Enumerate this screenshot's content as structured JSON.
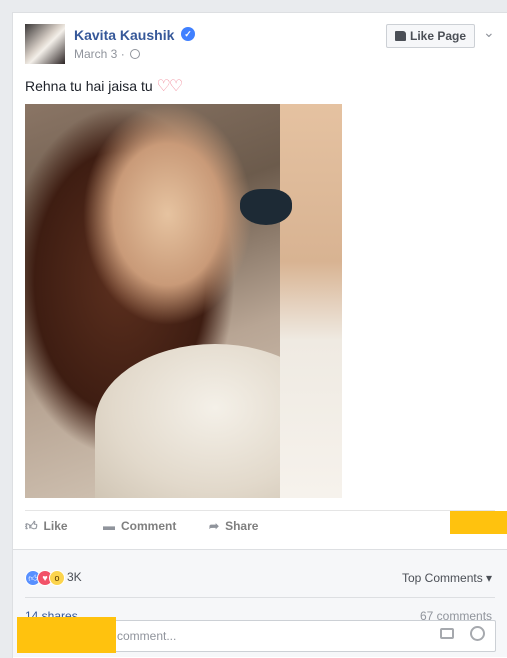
{
  "post": {
    "author": "Kavita Kaushik",
    "date": "March 3",
    "date_sep": "·",
    "text": "Rehna tu hai jaisa tu",
    "text_emoji": "♡♡",
    "like_page_label": "Like Page"
  },
  "actions": {
    "like": "Like",
    "comment": "Comment",
    "share": "Share"
  },
  "stats": {
    "reaction_count": "3K",
    "top_comments": "Top Comments ▾",
    "shares": "14 shares",
    "comments": "67 comments"
  },
  "comment_box": {
    "placeholder": "comment..."
  },
  "colors": {
    "link": "#365899",
    "redaction": "#ffc20e",
    "like_reaction": "#5890ff",
    "love_reaction": "#f25268",
    "wow_reaction": "#fcd44d"
  },
  "icons": {
    "verified": "verified-badge-icon",
    "globe": "globe-icon",
    "thumb": "thumbs-up-icon",
    "comment": "comment-bubble-icon",
    "share": "share-arrow-icon",
    "camera": "camera-icon",
    "emoji": "smiley-icon"
  }
}
